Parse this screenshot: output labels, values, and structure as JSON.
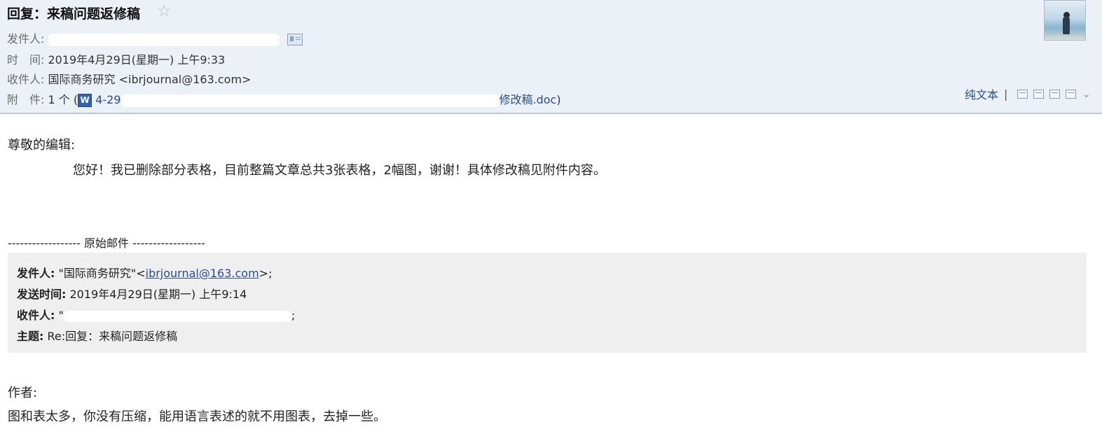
{
  "email": {
    "subject": "回复：来稿问题返修稿",
    "star_icon": "star-outline-icon",
    "from_label": "发件人:",
    "time_label": "时　间:",
    "time_value": "2019年4月29日(星期一) 上午9:33",
    "to_label": "收件人:",
    "to_value": "国际商务研究 <ibrjournal@163.com>",
    "attach_label": "附　件:",
    "attach_count": "1 个 (",
    "attach_prefix": "4-29",
    "attach_suffix": "修改稿.doc",
    "attach_close": ")"
  },
  "toolbar": {
    "plain_text": "纯文本",
    "separator": "|",
    "icons": [
      "new-window-icon",
      "print-preview-icon",
      "download-icon",
      "print-icon",
      "expand-chevron-icon"
    ]
  },
  "body": {
    "greeting": "尊敬的编辑:",
    "paragraph": "您好！我已删除部分表格，目前整篇文章总共3张表格，2幅图，谢谢！具体修改稿见附件内容。",
    "original_separator": "------------------ 原始邮件 ------------------"
  },
  "quoted": {
    "from_label": "发件人:",
    "from_name": " \"国际商务研究\"<",
    "from_email": "ibrjournal@163.com",
    "from_end": ">;",
    "sent_label": "发送时间:",
    "sent_value": " 2019年4月29日(星期一) 上午9:14",
    "to_label": "收件人:",
    "to_value_start": " \"",
    "to_value_end": ";",
    "subject_label": "主题:",
    "subject_value": " Re:回复：来稿问题返修稿"
  },
  "reply": {
    "author_label": "作者:",
    "comment": "图和表太多，你没有压缩，能用语言表述的就不用图表，去掉一些。"
  },
  "colors": {
    "header_bg": "#ecf1f7",
    "header_border": "#b7c8d9",
    "link": "#2a4d8f",
    "quote_bg": "#efefef"
  }
}
